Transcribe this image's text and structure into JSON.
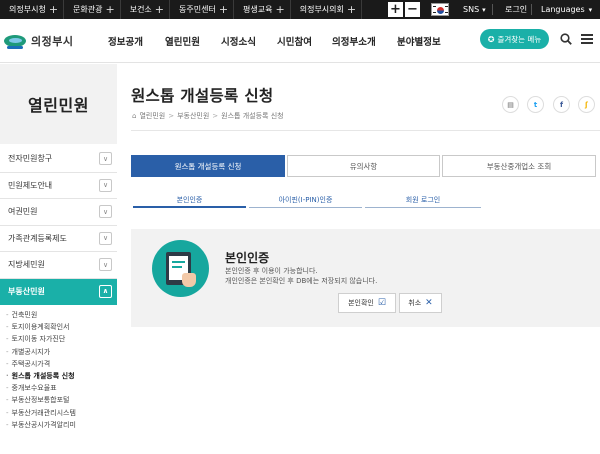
{
  "topbar": {
    "links": [
      "의정부시청",
      "문화관광",
      "보건소",
      "동주민센터",
      "평생교육",
      "의정부시의회"
    ],
    "zoom_in": "+",
    "zoom_out": "−",
    "sns": "SNS",
    "login": "로그인",
    "languages": "Languages"
  },
  "header": {
    "logo_text": "의정부시",
    "nav": [
      "정보공개",
      "열린민원",
      "시정소식",
      "시민참여",
      "의정부소개",
      "분야별정보"
    ],
    "favorite_menu": "즐겨찾는 메뉴"
  },
  "sidebar": {
    "title": "열린민원",
    "items": [
      {
        "label": "전자민원창구"
      },
      {
        "label": "민원제도안내"
      },
      {
        "label": "여권민원"
      },
      {
        "label": "가족관계등록제도"
      },
      {
        "label": "지방세민원"
      },
      {
        "label": "부동산민원"
      }
    ],
    "subitems": [
      "건축민원",
      "토지이용계획확인서",
      "토지이동 자가진단",
      "개별공시지가",
      "주택공시가격",
      "원스톱 개설등록 신청",
      "중개보수요율표",
      "부동산정보통합포털",
      "부동산거래관리시스템",
      "부동산공시가격알리미"
    ]
  },
  "main": {
    "title": "원스톱 개설등록 신청",
    "breadcrumb": [
      "열린민원",
      "부동산민원",
      "원스톱 개설등록 신청"
    ],
    "tabs": [
      "원스톱 개설등록 신청",
      "유의사항",
      "부동산중개업소 조회"
    ],
    "subtabs": [
      "본인인증",
      "아이핀(I-PIN)인증",
      "회원 로그인"
    ],
    "cert": {
      "title": "본인인증",
      "desc1": "본인인증 후 이용이 가능합니다.",
      "desc2": "개인인증은 본인확인 후 DB에는 저장되지 않습니다.",
      "confirm": "본인확인",
      "cancel": "취소"
    }
  },
  "colors": {
    "teal": "#1ab0a8",
    "blue": "#2a5fa8",
    "topbar": "#1a1a1a"
  }
}
